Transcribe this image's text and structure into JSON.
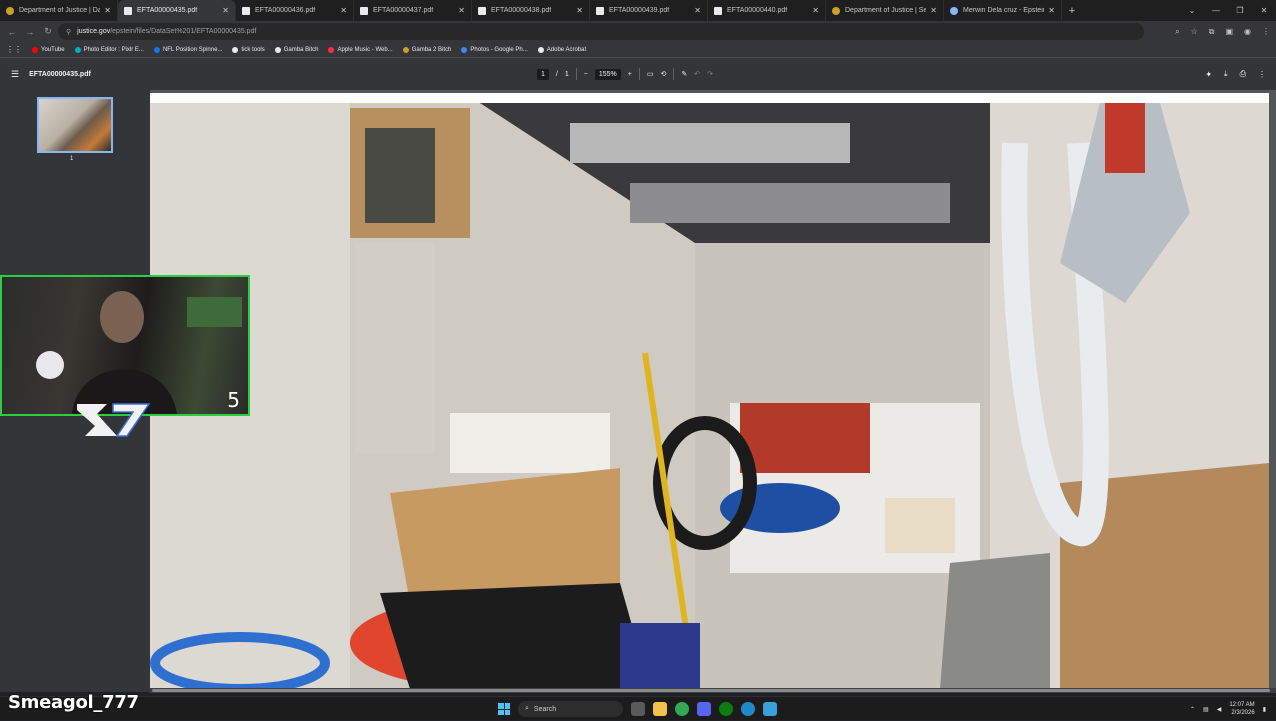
{
  "tabs": [
    {
      "title": "Department of Justice | Data Se",
      "icon": "doj-favicon",
      "active": false
    },
    {
      "title": "EFTA00000435.pdf",
      "icon": "pdf-favicon",
      "active": true
    },
    {
      "title": "EFTA00000436.pdf",
      "icon": "pdf-favicon",
      "active": false
    },
    {
      "title": "EFTA00000437.pdf",
      "icon": "pdf-favicon",
      "active": false
    },
    {
      "title": "EFTA00000438.pdf",
      "icon": "pdf-favicon",
      "active": false
    },
    {
      "title": "EFTA00000439.pdf",
      "icon": "pdf-favicon",
      "active": false
    },
    {
      "title": "EFTA00000440.pdf",
      "icon": "pdf-favicon",
      "active": false
    },
    {
      "title": "Department of Justice | Search",
      "icon": "doj-favicon",
      "active": false
    },
    {
      "title": "Merwin Dela cruz - Epstein We",
      "icon": "globe-favicon",
      "active": false
    }
  ],
  "omnibox": {
    "host": "justice.gov",
    "path": "/epstein/files/DataSet%201/EFTA00000435.pdf"
  },
  "bookmarks": [
    "YouTube",
    "Photo Editor : Pixlr E...",
    "NFL Position Spinne...",
    "tick tools",
    "Gamba Bitch",
    "Apple Music - Web...",
    "Gamba 2 Bitch",
    "Photos - Google Ph...",
    "Adobe Acrobat"
  ],
  "pdf": {
    "filename": "EFTA00000435.pdf",
    "page_current": "1",
    "page_sep": "/",
    "page_total": "1",
    "zoom": "155%",
    "thumb_label": "1"
  },
  "webcam": {
    "counter": "5"
  },
  "streamer": {
    "name": "Smeagol_777"
  },
  "taskbar": {
    "search_label": "Search",
    "time": "12:07 AM",
    "date": "2/3/2026"
  },
  "colors": {
    "accent": "#8ab4f8",
    "webcam_border": "#2ecc40",
    "pdf_toolbar": "#323639"
  }
}
